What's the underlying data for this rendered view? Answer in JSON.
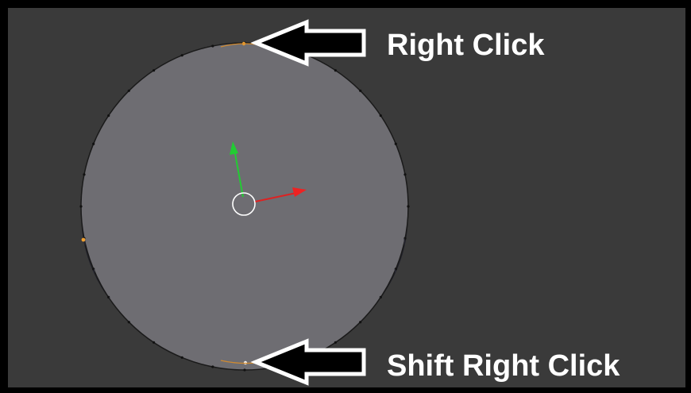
{
  "app": {
    "name": "Blender 3D viewport (edit mode)"
  },
  "annotations": {
    "top_label": "Right Click",
    "bottom_label": "Shift Right Click"
  },
  "viewport": {
    "mode": "edit-mode",
    "object": "circle-mesh",
    "selected_vertices": [
      "top-vertex",
      "bottom-vertex"
    ]
  },
  "icons": {
    "pointer_top": "arrow-left-icon",
    "pointer_bottom": "arrow-left-icon",
    "gizmo_x": "x-axis-arrow-icon",
    "gizmo_y": "y-axis-arrow-icon",
    "origin": "3d-cursor-icon"
  },
  "colors": {
    "viewport_bg": "#3a3a3a",
    "frame": "#000000",
    "mesh_face": "#6e6d72",
    "mesh_edge": "#1a1a1a",
    "selected_vertex": "#f0a030",
    "x_axis": "#dd2222",
    "y_axis": "#22cc33",
    "annotation_text": "#ffffff"
  }
}
